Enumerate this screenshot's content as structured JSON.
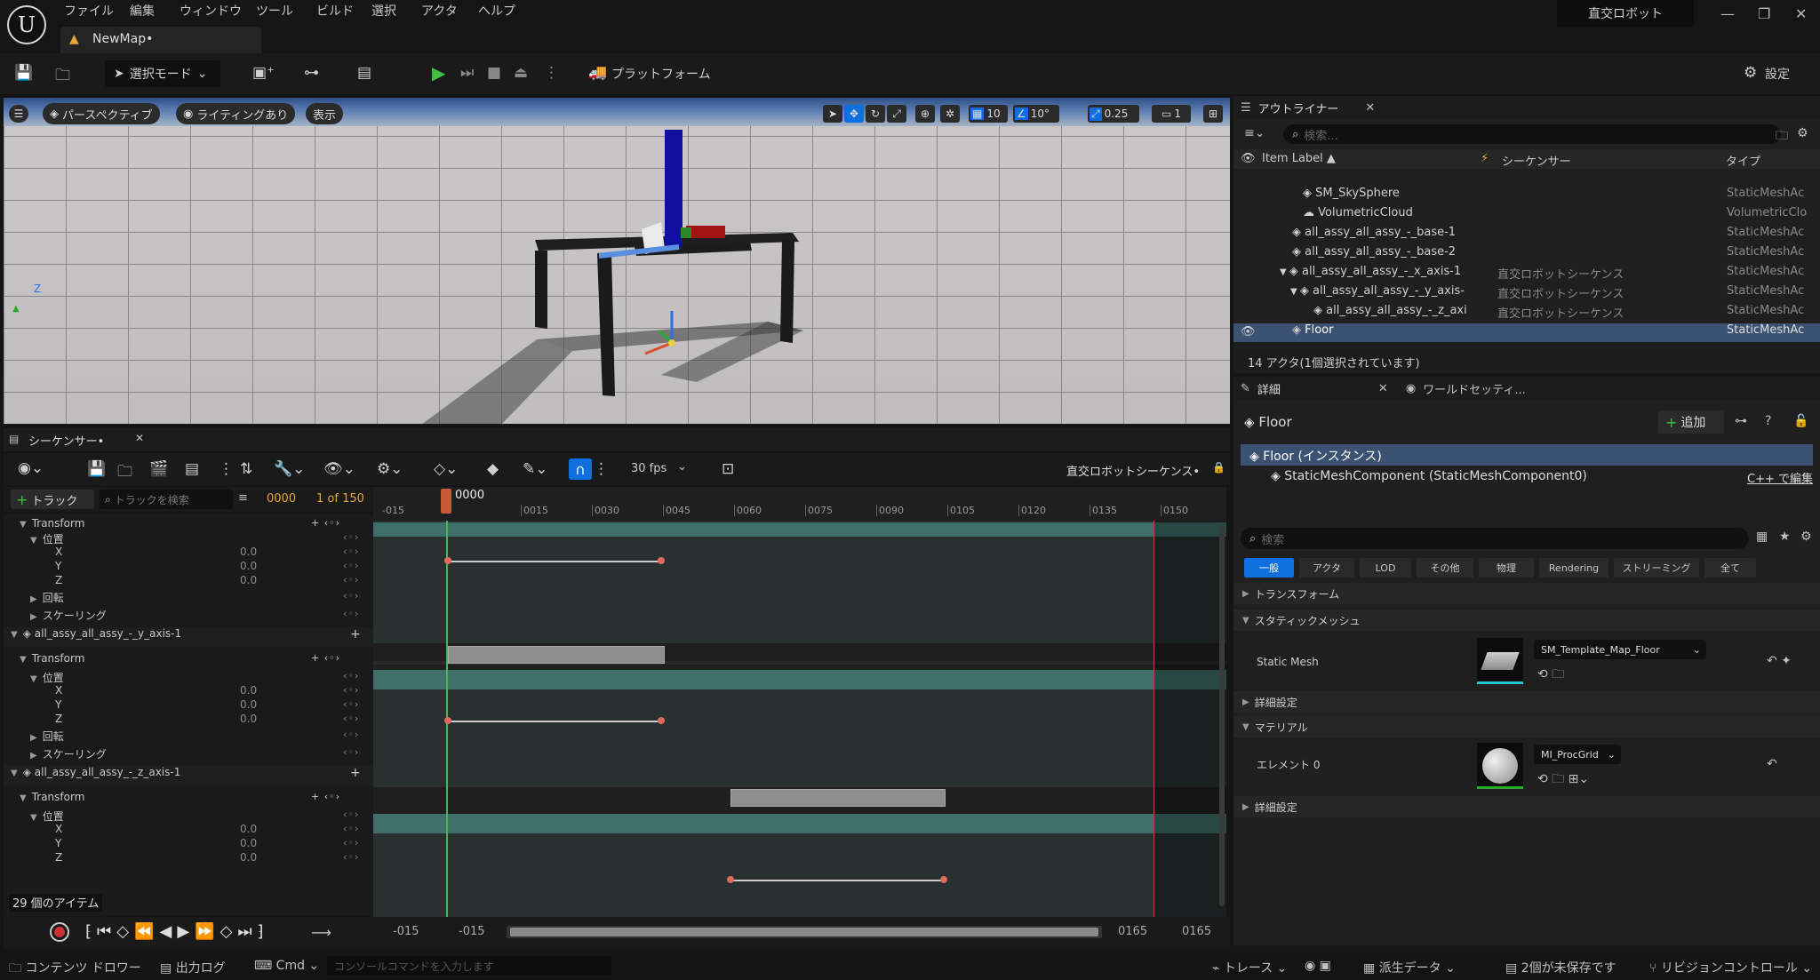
{
  "menu": [
    "ファイル",
    "編集",
    "ウィンドウ",
    "ツール",
    "ビルド",
    "選択",
    "アクタ",
    "ヘルプ"
  ],
  "project_name": "直交ロボット",
  "map_tab": "NewMap•",
  "toolbar": {
    "mode": "選択モード",
    "platform": "プラットフォーム",
    "settings": "設定"
  },
  "viewport": {
    "perspective": "パースペクティブ",
    "lighting": "ライティングあり",
    "show": "表示",
    "grid": "10",
    "angle": "10°",
    "scale": "0.25",
    "camera": "1",
    "axis_z": "Z"
  },
  "sequencer": {
    "tab": "シーケンサー•",
    "fps": "30 fps",
    "sequence_name": "直交ロボットシーケンス•",
    "add_track": "トラック",
    "search_placeholder": "トラックを検索",
    "frame": "0000",
    "of": "1 of 150",
    "playhead": "0000",
    "item_count": "29 個のアイテム",
    "ticks": [
      "-015",
      "0015",
      "0030",
      "0045",
      "0060",
      "0075",
      "0090",
      "0105",
      "0120",
      "0135",
      "0150"
    ],
    "range": {
      "start_a": "-015",
      "start_b": "-015",
      "end_a": "0165",
      "end_b": "0165"
    },
    "tracks": [
      {
        "label": "Transform",
        "type": "transform"
      },
      {
        "label": "位置",
        "type": "sub"
      },
      {
        "label": "X",
        "value": "0.0",
        "type": "axis"
      },
      {
        "label": "Y",
        "value": "0.0",
        "type": "axis"
      },
      {
        "label": "Z",
        "value": "0.0",
        "type": "axis"
      },
      {
        "label": "回転",
        "type": "sub"
      },
      {
        "label": "スケーリング",
        "type": "sub"
      },
      {
        "label": "all_assy_all_assy_-_y_axis-1",
        "type": "actor"
      },
      {
        "label": "Transform",
        "type": "transform"
      },
      {
        "label": "位置",
        "type": "sub"
      },
      {
        "label": "X",
        "value": "0.0",
        "type": "axis"
      },
      {
        "label": "Y",
        "value": "0.0",
        "type": "axis"
      },
      {
        "label": "Z",
        "value": "0.0",
        "type": "axis"
      },
      {
        "label": "回転",
        "type": "sub"
      },
      {
        "label": "スケーリング",
        "type": "sub"
      },
      {
        "label": "all_assy_all_assy_-_z_axis-1",
        "type": "actor"
      },
      {
        "label": "Transform",
        "type": "transform"
      },
      {
        "label": "位置",
        "type": "sub"
      },
      {
        "label": "X",
        "value": "0.0",
        "type": "axis"
      },
      {
        "label": "Y",
        "value": "0.0",
        "type": "axis"
      },
      {
        "label": "Z",
        "value": "0.0",
        "type": "axis"
      }
    ]
  },
  "outliner": {
    "tab": "アウトライナー",
    "search_placeholder": "検索...",
    "col_label": "Item Label ▲",
    "col_seq": "シーケンサー",
    "col_type": "タイプ",
    "items": [
      {
        "label": "SM_SkySphere",
        "seq": "",
        "type": "StaticMeshAc"
      },
      {
        "label": "VolumetricCloud",
        "seq": "",
        "type": "VolumetricClo"
      },
      {
        "label": "all_assy_all_assy_-_base-1",
        "seq": "",
        "type": "StaticMeshAc"
      },
      {
        "label": "all_assy_all_assy_-_base-2",
        "seq": "",
        "type": "StaticMeshAc"
      },
      {
        "label": "all_assy_all_assy_-_x_axis-1",
        "seq": "直交ロボットシーケンス",
        "type": "StaticMeshAc"
      },
      {
        "label": "all_assy_all_assy_-_y_axis-",
        "seq": "直交ロボットシーケンス",
        "type": "StaticMeshAc"
      },
      {
        "label": "all_assy_all_assy_-_z_axi",
        "seq": "直交ロボットシーケンス",
        "type": "StaticMeshAc"
      },
      {
        "label": "Floor",
        "seq": "",
        "type": "StaticMeshAc"
      }
    ],
    "status": "14 アクタ(1個選択されています)"
  },
  "details": {
    "tab": "詳細",
    "world_tab": "ワールドセッティ...",
    "actor": "Floor",
    "add": "追加",
    "instance": "Floor (インスタンス)",
    "component": "StaticMeshComponent (StaticMeshComponent0)",
    "cpp": "C++ で編集",
    "search_placeholder": "検索",
    "filters": [
      "一般",
      "アクタ",
      "LOD",
      "その他",
      "物理",
      "Rendering",
      "ストリーミング",
      "全て"
    ],
    "sections": {
      "transform": "トランスフォーム",
      "static_mesh": "スタティックメッシュ",
      "advanced1": "詳細設定",
      "material": "マテリアル",
      "advanced2": "詳細設定"
    },
    "static_mesh_label": "Static Mesh",
    "static_mesh_value": "SM_Template_Map_Floor",
    "element_label": "エレメント 0",
    "material_value": "MI_ProcGrid"
  },
  "statusbar": {
    "content": "コンテンツ ドロワー",
    "log": "出力ログ",
    "cmd": "Cmd",
    "console_placeholder": "コンソールコマンドを入力します",
    "trace": "トレース",
    "derived": "派生データ",
    "unsaved": "2個が未保存です",
    "revision": "リビジョンコントロール"
  },
  "colors": {
    "accent": "#0f6fde",
    "teal": "#3f6f68",
    "key": "#e06a5e"
  }
}
